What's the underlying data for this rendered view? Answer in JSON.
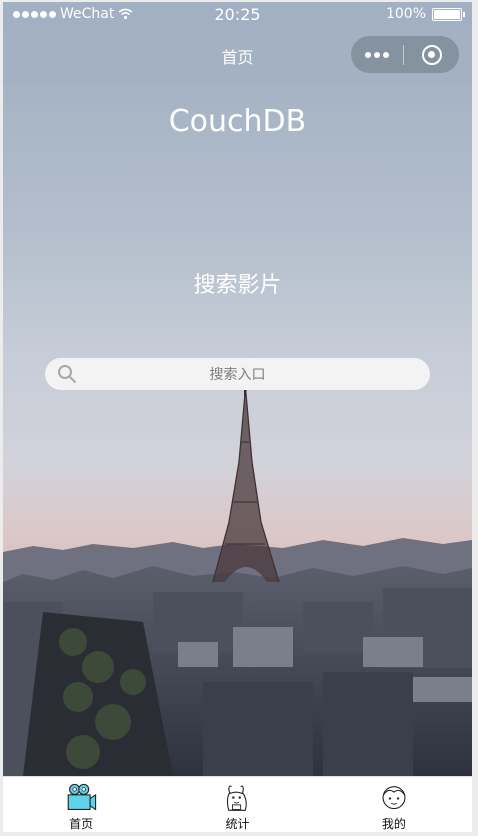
{
  "status_bar": {
    "carrier": "WeChat",
    "time": "20:25",
    "battery": "100%"
  },
  "nav": {
    "title": "首页"
  },
  "hero": {
    "app_title": "CouchDB",
    "section_title": "搜索影片"
  },
  "search": {
    "placeholder": "搜索入口"
  },
  "tabs": [
    {
      "label": "首页",
      "icon": "camera-icon"
    },
    {
      "label": "统计",
      "icon": "stats-icon"
    },
    {
      "label": "我的",
      "icon": "profile-icon"
    }
  ]
}
